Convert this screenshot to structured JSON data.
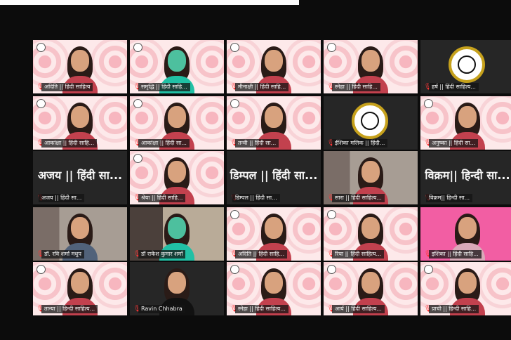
{
  "top_banner_text": "",
  "participants": [
    {
      "name": "अदिति || हिंदी साहित्य",
      "type": "video",
      "theme": "mandala",
      "row": 1,
      "col": 1
    },
    {
      "name": "समृद्धि || हिंदी साहि...",
      "type": "video",
      "theme": "mandala-green",
      "row": 1,
      "col": 2
    },
    {
      "name": "मीनाक्षी || हिंदी साहि...",
      "type": "video",
      "theme": "mandala",
      "row": 1,
      "col": 3
    },
    {
      "name": "स्नेहा || हिंदी साहि...",
      "type": "video",
      "theme": "mandala",
      "row": 1,
      "col": 4
    },
    {
      "name": "हर्ष || हिंदी साहित्य...",
      "type": "badge",
      "theme": "logo",
      "row": 1,
      "col": 5
    },
    {
      "name": "आकांक्षा || हिंदी साहि...",
      "type": "video",
      "theme": "mandala",
      "row": 2,
      "col": 1
    },
    {
      "name": "आकांक्षा || हिंदी सा...",
      "type": "video",
      "theme": "mandala",
      "row": 2,
      "col": 2
    },
    {
      "name": "तन्वी || हिंदी सा...",
      "type": "video",
      "theme": "mandala",
      "row": 2,
      "col": 3
    },
    {
      "name": "ईशिका मलिक || हिंदी...",
      "type": "badge",
      "theme": "logo",
      "row": 2,
      "col": 4
    },
    {
      "name": "अनुष्का || हिंदी सा...",
      "type": "video",
      "theme": "mandala",
      "row": 2,
      "col": 5
    },
    {
      "name": "अजय || हिंदी सा...",
      "type": "name",
      "theme": "dark",
      "row": 3,
      "col": 1
    },
    {
      "name": "श्रेया || हिंदी साहि...",
      "type": "video",
      "theme": "mandala",
      "row": 3,
      "col": 2
    },
    {
      "name": "डिम्पल || हिंदी सा...",
      "type": "name",
      "theme": "dark",
      "row": 3,
      "col": 3
    },
    {
      "name": "सारा || हिंदी साहित्य...",
      "type": "video",
      "theme": "room",
      "row": 3,
      "col": 4
    },
    {
      "name": "विक्रम|| हिन्दी सा...",
      "type": "name",
      "theme": "dark",
      "row": 3,
      "col": 5
    },
    {
      "name": "डॉ. रवि शर्मा मधुप",
      "type": "video",
      "theme": "room-active",
      "row": 4,
      "col": 1
    },
    {
      "name": "डॉ राकेश कुमार शर्मा",
      "type": "video",
      "theme": "room-dark",
      "row": 4,
      "col": 2
    },
    {
      "name": "अदिति || हिंदी साहि...",
      "type": "video",
      "theme": "mandala",
      "row": 4,
      "col": 3
    },
    {
      "name": "रिया || हिंदी साहित्य...",
      "type": "video",
      "theme": "mandala",
      "row": 4,
      "col": 4
    },
    {
      "name": "इशिका || हिंदी साहि...",
      "type": "video",
      "theme": "pink",
      "row": 4,
      "col": 5
    },
    {
      "name": "तान्या || हिन्दी साहित्य...",
      "type": "video",
      "theme": "mandala",
      "row": 5,
      "col": 1
    },
    {
      "name": "Ravin Chhabra",
      "type": "video",
      "theme": "dark-person",
      "row": 5,
      "col": 2
    },
    {
      "name": "स्नेहा || हिंदी साहित्य...",
      "type": "video",
      "theme": "mandala",
      "row": 5,
      "col": 3
    },
    {
      "name": "आर्य || हिंदी साहित्य...",
      "type": "video",
      "theme": "mandala",
      "row": 5,
      "col": 4
    },
    {
      "name": "प्राची || हिन्दी साहि...",
      "type": "video",
      "theme": "mandala",
      "row": 5,
      "col": 5
    }
  ],
  "icons": {
    "muted_mic": "red-muted-mic-icon",
    "host_logo": "hindi-sahitya-logo-icon"
  },
  "colors": {
    "background": "#0c0c0c",
    "tile_pink": "#fde9ea",
    "active_speaker": "#c6d94a",
    "muted": "#ff3434"
  }
}
